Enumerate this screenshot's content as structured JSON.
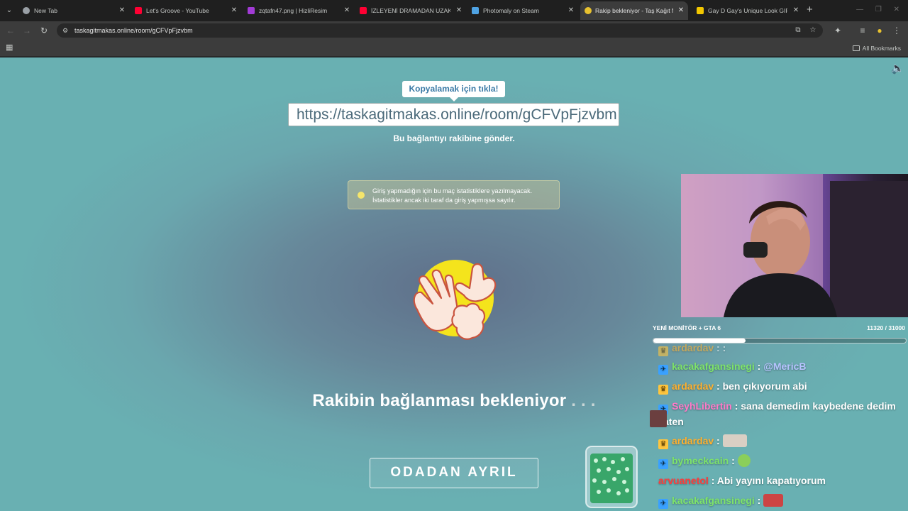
{
  "browser": {
    "tabs": [
      {
        "title": "New Tab",
        "favicon_color": "#9aa0a6"
      },
      {
        "title": "Let's Groove - YouTube",
        "favicon_color": "#ff0033"
      },
      {
        "title": "zqtafn47.png | HizliResim",
        "favicon_color": "#a23bd6"
      },
      {
        "title": "İZLEYENİ DRAMADAN UZAK TUTAN",
        "favicon_color": "#ff0033"
      },
      {
        "title": "Photomaly on Steam",
        "favicon_color": "#4fa3e3"
      },
      {
        "title": "Rakip bekleniyor - Taş Kağıt Makas",
        "favicon_color": "#e8c22f",
        "active": true
      },
      {
        "title": "Gay D Gay's Unique Look GIF - ",
        "favicon_color": "#f2c700"
      }
    ],
    "url": "taskagitmakas.online/room/gCFVpFjzvbm",
    "bookmarks_label": "All Bookmarks"
  },
  "page": {
    "copy_tooltip": "Kopyalamak için tıkla!",
    "room_link": "https://taskagitmakas.online/room/gCFVpFjzvbm",
    "send_instruction": "Bu bağlantıyı rakibine gönder.",
    "notice_line1": "Giriş yapmadığın için bu maç istatistiklere yazılmayacak.",
    "notice_line2": "İstatistikler ancak iki taraf da giriş yapmışsa sayılır.",
    "waiting_text": "Rakibin bağlanması bekleniyor",
    "waiting_dots": ". . .",
    "leave_button": "ODADAN AYRIL"
  },
  "stream": {
    "goal_label": "YENİ MONİTÖR + GTA 6",
    "goal_count": "11320 / 31000",
    "goal_progress": 0.365,
    "chat": [
      {
        "user": "ardardav",
        "message": ": :"
      },
      {
        "user": "kacakafgansinegi",
        "message": ": ",
        "mention": "@MericB"
      },
      {
        "user": "ardardav",
        "message": ": ben çıkıyorum abi"
      },
      {
        "user": "SeyhLibertin",
        "message": ": sana demedim kaybedene dedim",
        "message_wrap": "zaten"
      },
      {
        "user": "ardardav",
        "message": ":"
      },
      {
        "user": "bymeckcain",
        "message": ":"
      },
      {
        "user": "arvuanetol",
        "message": ": Abi yayını kapatıyorum"
      },
      {
        "user": "kacakafgansinegi",
        "message": ":"
      }
    ]
  }
}
